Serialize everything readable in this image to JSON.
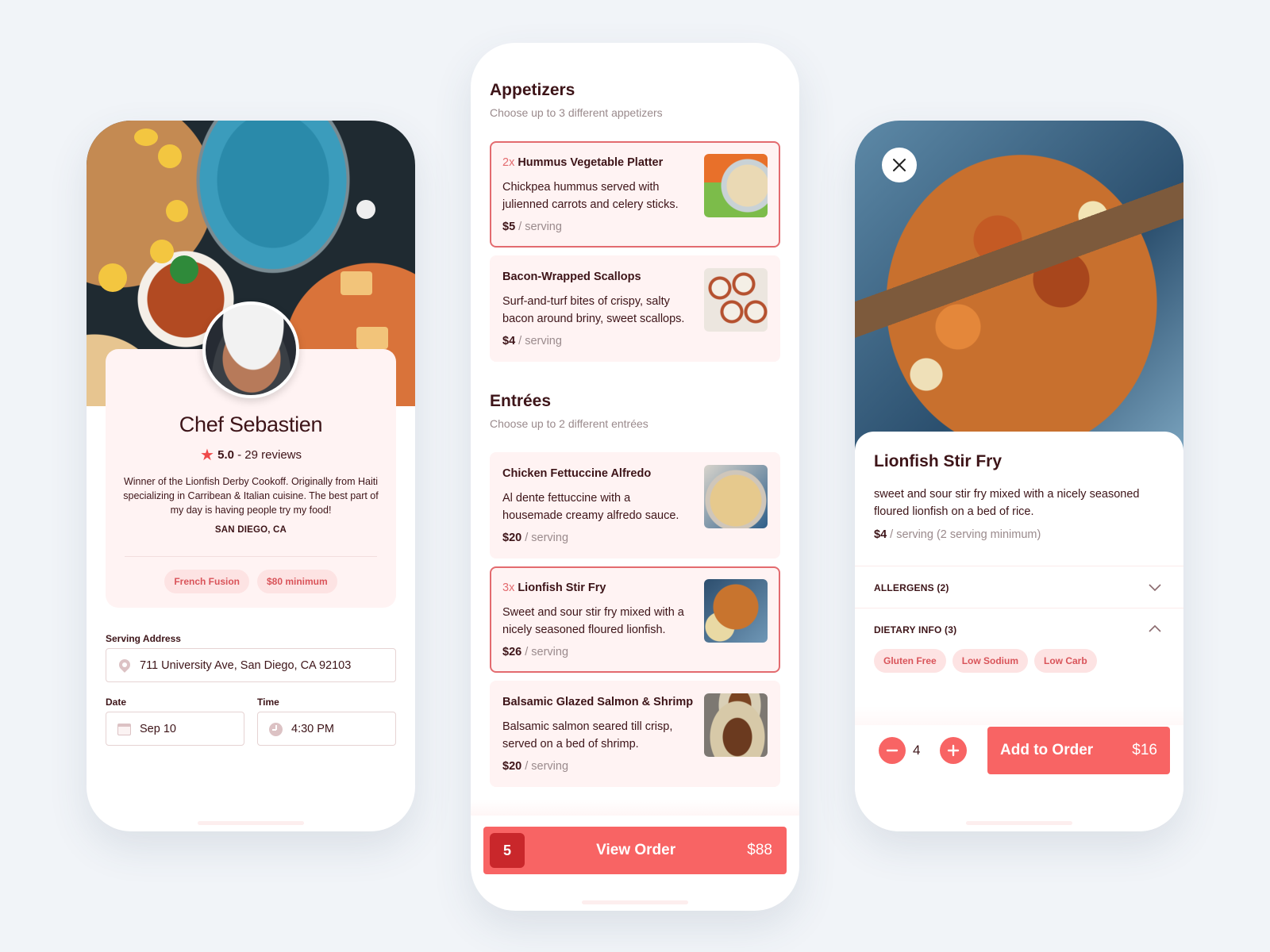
{
  "chef_profile": {
    "name": "Chef Sebastien",
    "rating": "5.0",
    "reviews": "- 29 reviews",
    "bio": "Winner of the Lionfish Derby Cookoff. Originally from Haiti specializing in Carribean & Italian cuisine. The best part of my day is having people try my food!",
    "location": "SAN DIEGO, CA",
    "tags": [
      "French Fusion",
      "$80 minimum"
    ],
    "form": {
      "address_label": "Serving Address",
      "address_value": "711 University Ave, San Diego, CA 92103",
      "date_label": "Date",
      "date_value": "Sep 10",
      "time_label": "Time",
      "time_value": "4:30 PM"
    }
  },
  "menu": {
    "sections": [
      {
        "title": "Appetizers",
        "subtitle": "Choose up to 3 different appetizers",
        "items": [
          {
            "qty": "2x",
            "name": "Hummus Vegetable Platter",
            "desc": "Chickpea hummus served with julienned carrots and celery sticks.",
            "price": "$5",
            "unit": "/ serving",
            "selected": true
          },
          {
            "qty": "",
            "name": "Bacon-Wrapped Scallops",
            "desc": "Surf-and-turf bites of crispy, salty bacon around briny, sweet scallops.",
            "price": "$4",
            "unit": "/ serving",
            "selected": false
          }
        ]
      },
      {
        "title": "Entrées",
        "subtitle": "Choose up to 2 different entrées",
        "items": [
          {
            "qty": "",
            "name": "Chicken Fettuccine Alfredo",
            "desc": "Al dente fettuccine with a housemade creamy alfredo sauce.",
            "price": "$20",
            "unit": "/ serving",
            "selected": false
          },
          {
            "qty": "3x",
            "name": "Lionfish Stir Fry",
            "desc": "Sweet and sour stir fry mixed with a nicely seasoned floured lionfish.",
            "price": "$26",
            "unit": "/ serving",
            "selected": true
          },
          {
            "qty": "",
            "name": "Balsamic Glazed Salmon & Shrimp",
            "desc": "Balsamic salmon seared till crisp, served on a bed of shrimp.",
            "price": "$20",
            "unit": "/ serving",
            "selected": false
          }
        ]
      }
    ],
    "order_bar": {
      "count": "5",
      "label": "View Order",
      "total": "$88"
    }
  },
  "dish_detail": {
    "title": "Lionfish Stir Fry",
    "description": "sweet and sour stir fry mixed with a nicely seasoned floured lionfish on a bed of rice.",
    "price": "$4",
    "price_unit": "/ serving (2 serving minimum)",
    "allergens_label": "ALLERGENS (2)",
    "dietary_label": "DIETARY INFO (3)",
    "dietary_tags": [
      "Gluten Free",
      "Low Sodium",
      "Low Carb"
    ],
    "quantity": "4",
    "add_label": "Add to Order",
    "add_price": "$16"
  },
  "colors": {
    "accent": "#f86464",
    "accent_dark": "#c9272b",
    "selected_border": "#e36b6f",
    "card_bg": "#fff3f3",
    "text": "#3d1418",
    "muted": "#9a8a8c"
  }
}
